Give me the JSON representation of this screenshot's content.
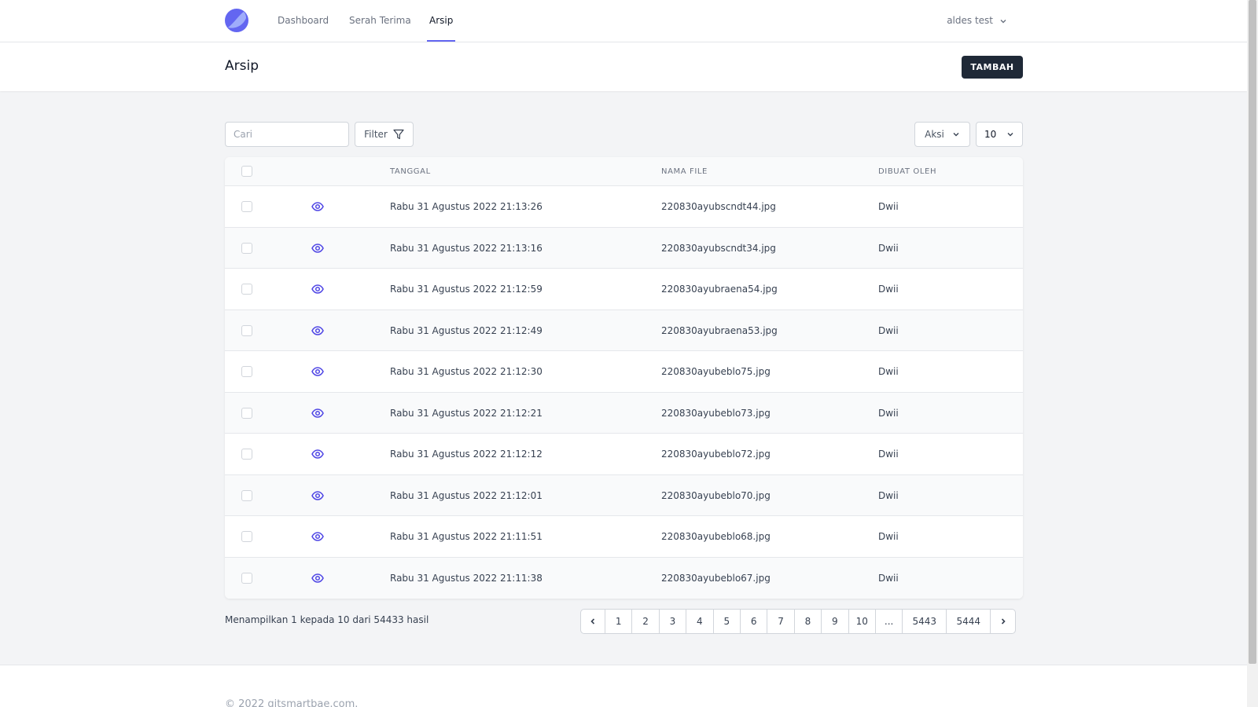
{
  "nav": {
    "items": [
      {
        "label": "Dashboard"
      },
      {
        "label": "Serah Terima"
      },
      {
        "label": "Arsip"
      }
    ],
    "user": "aldes test"
  },
  "header": {
    "title": "Arsip",
    "add_label": "TAMBAH"
  },
  "toolbar": {
    "search_placeholder": "Cari",
    "filter_label": "Filter",
    "aksi_label": "Aksi",
    "per_page": "10"
  },
  "table": {
    "headers": {
      "tanggal": "TANGGAL",
      "nama_file": "NAMA FILE",
      "dibuat_oleh": "DIBUAT OLEH"
    },
    "rows": [
      {
        "tanggal": "Rabu 31 Agustus 2022 21:13:26",
        "nama_file": "220830ayubscndt44.jpg",
        "dibuat_oleh": "Dwii"
      },
      {
        "tanggal": "Rabu 31 Agustus 2022 21:13:16",
        "nama_file": "220830ayubscndt34.jpg",
        "dibuat_oleh": "Dwii"
      },
      {
        "tanggal": "Rabu 31 Agustus 2022 21:12:59",
        "nama_file": "220830ayubraena54.jpg",
        "dibuat_oleh": "Dwii"
      },
      {
        "tanggal": "Rabu 31 Agustus 2022 21:12:49",
        "nama_file": "220830ayubraena53.jpg",
        "dibuat_oleh": "Dwii"
      },
      {
        "tanggal": "Rabu 31 Agustus 2022 21:12:30",
        "nama_file": "220830ayubeblo75.jpg",
        "dibuat_oleh": "Dwii"
      },
      {
        "tanggal": "Rabu 31 Agustus 2022 21:12:21",
        "nama_file": "220830ayubeblo73.jpg",
        "dibuat_oleh": "Dwii"
      },
      {
        "tanggal": "Rabu 31 Agustus 2022 21:12:12",
        "nama_file": "220830ayubeblo72.jpg",
        "dibuat_oleh": "Dwii"
      },
      {
        "tanggal": "Rabu 31 Agustus 2022 21:12:01",
        "nama_file": "220830ayubeblo70.jpg",
        "dibuat_oleh": "Dwii"
      },
      {
        "tanggal": "Rabu 31 Agustus 2022 21:11:51",
        "nama_file": "220830ayubeblo68.jpg",
        "dibuat_oleh": "Dwii"
      },
      {
        "tanggal": "Rabu 31 Agustus 2022 21:11:38",
        "nama_file": "220830ayubeblo67.jpg",
        "dibuat_oleh": "Dwii"
      }
    ]
  },
  "summary": "Menampilkan 1 kepada 10 dari 54433 hasil",
  "pagination": {
    "pages": [
      "1",
      "2",
      "3",
      "4",
      "5",
      "6",
      "7",
      "8",
      "9",
      "10"
    ],
    "ellipsis": "...",
    "last_pages": [
      "5443",
      "5444"
    ]
  },
  "footer": {
    "copyright": "© 2022 gitsmartbae.com."
  },
  "colors": {
    "accent": "#6366f1",
    "primary_button": "#1f2937",
    "eye_icon": "#4f46e5"
  },
  "icons": {
    "logo": "moon-logo-icon",
    "filter": "funnel-icon",
    "view": "eye-icon",
    "dropdown": "chevron-down-icon",
    "prev": "chevron-left-icon",
    "next": "chevron-right-icon"
  }
}
